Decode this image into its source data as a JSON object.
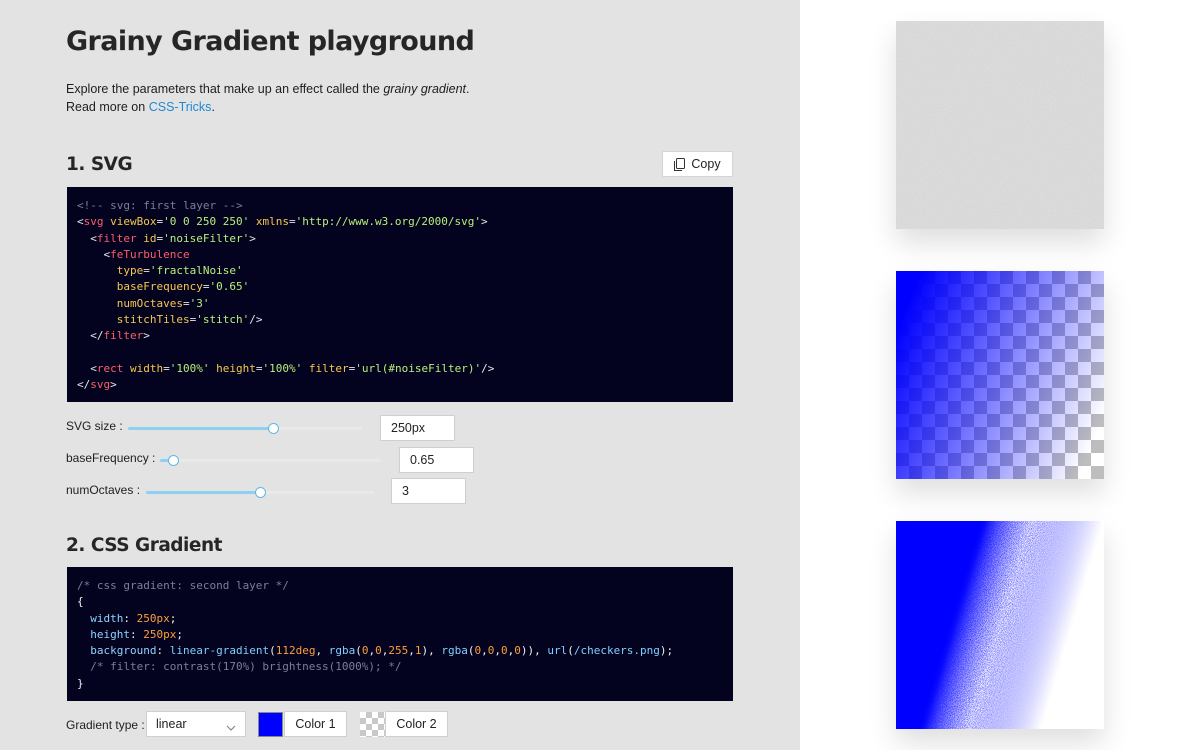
{
  "page": {
    "title": "Grainy Gradient playground",
    "intro_text": "Explore the parameters that make up an effect called the",
    "intro_emphasis": "grainy gradient",
    "intro_period": ".",
    "intro_read_more": "Read more on",
    "intro_link": "CSS-Tricks",
    "intro_link_end": "."
  },
  "svg_section": {
    "title": "1. SVG",
    "copy_label": "Copy",
    "code_lines": [
      [
        [
          "t-comment",
          "<!-- svg: first layer -->"
        ]
      ],
      [
        [
          "t-punct",
          "<"
        ],
        [
          "t-tag",
          "svg"
        ],
        [
          "t-plain",
          " "
        ],
        [
          "t-attr",
          "viewBox"
        ],
        [
          "t-punct",
          "="
        ],
        [
          "t-str",
          "'0 0 250 250'"
        ],
        [
          "t-plain",
          " "
        ],
        [
          "t-attr",
          "xmlns"
        ],
        [
          "t-punct",
          "="
        ],
        [
          "t-str",
          "'http://www.w3.org/2000/svg'"
        ],
        [
          "t-punct",
          ">"
        ]
      ],
      [
        [
          "t-plain",
          "  "
        ],
        [
          "t-punct",
          "<"
        ],
        [
          "t-tag",
          "filter"
        ],
        [
          "t-plain",
          " "
        ],
        [
          "t-attr",
          "id"
        ],
        [
          "t-punct",
          "="
        ],
        [
          "t-str",
          "'noiseFilter'"
        ],
        [
          "t-punct",
          ">"
        ]
      ],
      [
        [
          "t-plain",
          "    "
        ],
        [
          "t-punct",
          "<"
        ],
        [
          "t-tag",
          "feTurbulence"
        ]
      ],
      [
        [
          "t-plain",
          "      "
        ],
        [
          "t-attr",
          "type"
        ],
        [
          "t-punct",
          "="
        ],
        [
          "t-str",
          "'fractalNoise'"
        ]
      ],
      [
        [
          "t-plain",
          "      "
        ],
        [
          "t-attr",
          "baseFrequency"
        ],
        [
          "t-punct",
          "="
        ],
        [
          "t-str",
          "'0.65'"
        ]
      ],
      [
        [
          "t-plain",
          "      "
        ],
        [
          "t-attr",
          "numOctaves"
        ],
        [
          "t-punct",
          "="
        ],
        [
          "t-str",
          "'3'"
        ]
      ],
      [
        [
          "t-plain",
          "      "
        ],
        [
          "t-attr",
          "stitchTiles"
        ],
        [
          "t-punct",
          "="
        ],
        [
          "t-str",
          "'stitch'"
        ],
        [
          "t-punct",
          "/>"
        ]
      ],
      [
        [
          "t-plain",
          "  "
        ],
        [
          "t-punct",
          "</"
        ],
        [
          "t-tag",
          "filter"
        ],
        [
          "t-punct",
          ">"
        ]
      ],
      [
        [
          "t-plain",
          ""
        ]
      ],
      [
        [
          "t-plain",
          "  "
        ],
        [
          "t-punct",
          "<"
        ],
        [
          "t-tag",
          "rect"
        ],
        [
          "t-plain",
          " "
        ],
        [
          "t-attr",
          "width"
        ],
        [
          "t-punct",
          "="
        ],
        [
          "t-str",
          "'100%'"
        ],
        [
          "t-plain",
          " "
        ],
        [
          "t-attr",
          "height"
        ],
        [
          "t-punct",
          "="
        ],
        [
          "t-str",
          "'100%'"
        ],
        [
          "t-plain",
          " "
        ],
        [
          "t-attr",
          "filter"
        ],
        [
          "t-punct",
          "="
        ],
        [
          "t-str",
          "'url(#noiseFilter)'"
        ],
        [
          "t-punct",
          "/>"
        ]
      ],
      [
        [
          "t-punct",
          "</"
        ],
        [
          "t-tag",
          "svg"
        ],
        [
          "t-punct",
          ">"
        ]
      ]
    ],
    "controls": [
      {
        "label": "SVG size",
        "value": "250px",
        "fraction": 0.62
      },
      {
        "label": "baseFrequency",
        "value": "0.65",
        "fraction": 0.06
      },
      {
        "label": "numOctaves",
        "value": "3",
        "fraction": 0.5
      }
    ]
  },
  "css_section": {
    "title": "2. CSS Gradient",
    "code_lines": [
      [
        [
          "t-comment",
          "/* css gradient: second layer */"
        ]
      ],
      [
        [
          "t-plain",
          "{"
        ]
      ],
      [
        [
          "t-plain",
          "  "
        ],
        [
          "t-prop",
          "width"
        ],
        [
          "t-plain",
          ": "
        ],
        [
          "t-num",
          "250px"
        ],
        [
          "t-plain",
          ";"
        ]
      ],
      [
        [
          "t-plain",
          "  "
        ],
        [
          "t-prop",
          "height"
        ],
        [
          "t-plain",
          ": "
        ],
        [
          "t-num",
          "250px"
        ],
        [
          "t-plain",
          ";"
        ]
      ],
      [
        [
          "t-plain",
          "  "
        ],
        [
          "t-prop",
          "background"
        ],
        [
          "t-plain",
          ": "
        ],
        [
          "t-func",
          "linear-gradient"
        ],
        [
          "t-plain",
          "("
        ],
        [
          "t-num",
          "112deg"
        ],
        [
          "t-plain",
          ", "
        ],
        [
          "t-func",
          "rgba"
        ],
        [
          "t-plain",
          "("
        ],
        [
          "t-num",
          "0"
        ],
        [
          "t-plain",
          ","
        ],
        [
          "t-num",
          "0"
        ],
        [
          "t-plain",
          ","
        ],
        [
          "t-num",
          "255"
        ],
        [
          "t-plain",
          ","
        ],
        [
          "t-num",
          "1"
        ],
        [
          "t-plain",
          "), "
        ],
        [
          "t-func",
          "rgba"
        ],
        [
          "t-plain",
          "("
        ],
        [
          "t-num",
          "0"
        ],
        [
          "t-plain",
          ","
        ],
        [
          "t-num",
          "0"
        ],
        [
          "t-plain",
          ","
        ],
        [
          "t-num",
          "0"
        ],
        [
          "t-plain",
          ","
        ],
        [
          "t-num",
          "0"
        ],
        [
          "t-plain",
          ")), "
        ],
        [
          "t-func",
          "url"
        ],
        [
          "t-plain",
          "("
        ],
        [
          "t-func",
          "/checkers.png"
        ],
        [
          "t-plain",
          ");"
        ]
      ],
      [
        [
          "t-plain",
          "  "
        ],
        [
          "t-comment",
          "/* filter: contrast(170%) brightness(1000%); */"
        ]
      ],
      [
        [
          "t-plain",
          "}"
        ]
      ]
    ],
    "gradient_type_label": "Gradient type",
    "gradient_type_value": "linear",
    "color1_label": "Color 1",
    "color2_label": "Color 2",
    "color1": "#0000ff"
  },
  "icons": {
    "copy": "clipboard-icon",
    "select": "chevron-down-icon"
  },
  "colors": {
    "link": "#1f8ad1",
    "code_bg": "#04031f",
    "panel_bg": "#e3e3e3",
    "accent_blue": "#0000ff",
    "slider_fill": "#8fcff2"
  }
}
